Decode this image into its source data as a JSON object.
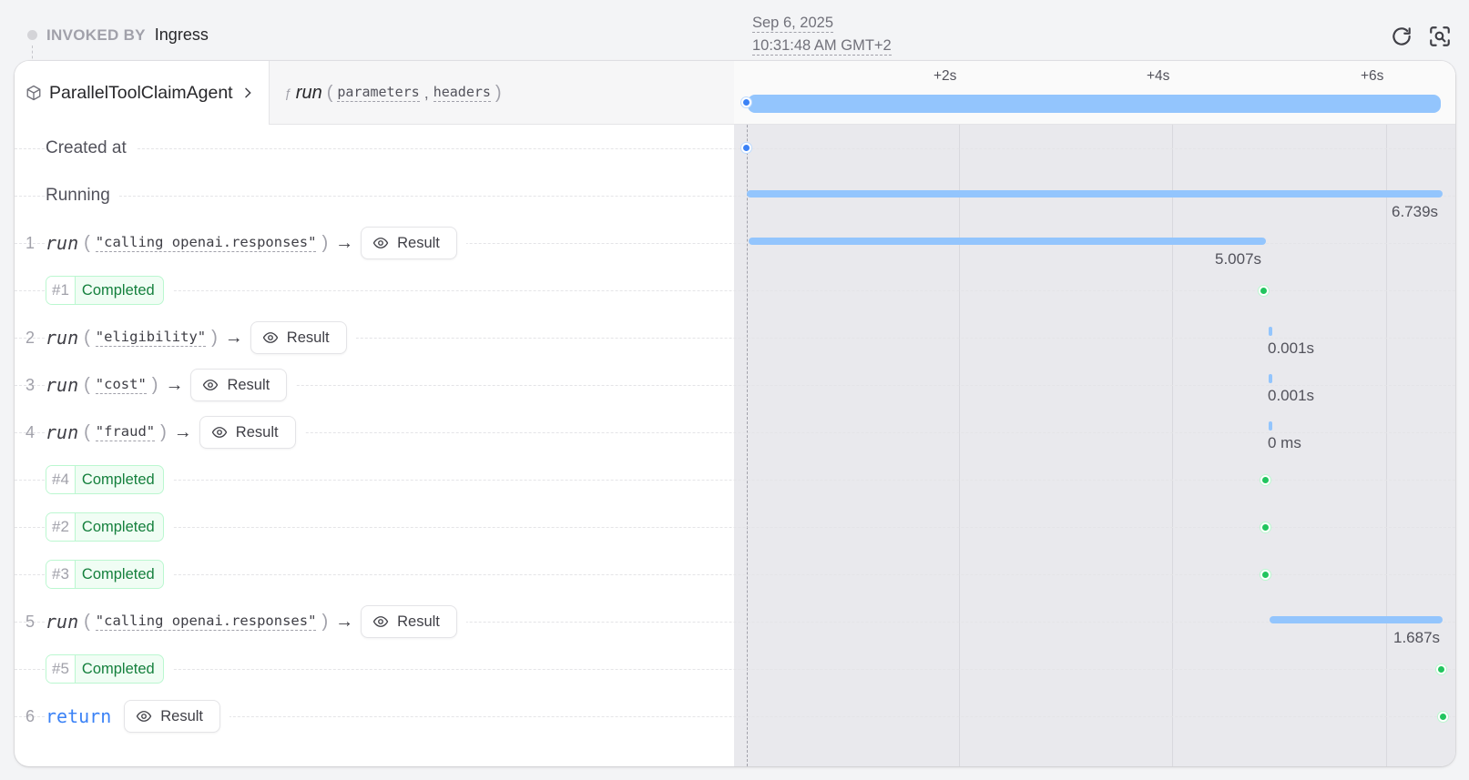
{
  "header": {
    "invoked_label": "INVOKED BY",
    "invoked_by": "Ingress",
    "date": "Sep 6, 2025",
    "time": "10:31:48 AM GMT+2",
    "icons": [
      "refresh-icon",
      "zoom-fit-icon"
    ]
  },
  "invocation": {
    "service": "ParallelToolClaimAgent",
    "function": "run",
    "params": [
      "parameters",
      "headers"
    ],
    "ticks": [
      "+2s",
      "+4s",
      "+6s"
    ]
  },
  "rows": {
    "created": {
      "label": "Created at"
    },
    "running": {
      "label": "Running",
      "duration": "6.739s"
    },
    "r1": {
      "num": "1",
      "kw": "run",
      "arg": "\"calling openai.responses\"",
      "btn": "Result",
      "duration": "5.007s"
    },
    "c1": {
      "id": "#1",
      "status": "Completed"
    },
    "r2": {
      "num": "2",
      "kw": "run",
      "arg": "\"eligibility\"",
      "btn": "Result",
      "duration": "0.001s"
    },
    "r3": {
      "num": "3",
      "kw": "run",
      "arg": "\"cost\"",
      "btn": "Result",
      "duration": "0.001s"
    },
    "r4": {
      "num": "4",
      "kw": "run",
      "arg": "\"fraud\"",
      "btn": "Result",
      "duration": "0 ms"
    },
    "c4": {
      "id": "#4",
      "status": "Completed"
    },
    "c2": {
      "id": "#2",
      "status": "Completed"
    },
    "c3": {
      "id": "#3",
      "status": "Completed"
    },
    "r5": {
      "num": "5",
      "kw": "run",
      "arg": "\"calling openai.responses\"",
      "btn": "Result",
      "duration": "1.687s"
    },
    "c5": {
      "id": "#5",
      "status": "Completed"
    },
    "r6": {
      "num": "6",
      "kw": "return",
      "btn": "Result"
    }
  },
  "colors": {
    "accent": "#3b82f6",
    "bar": "#93c5fd",
    "success": "#15803d"
  }
}
